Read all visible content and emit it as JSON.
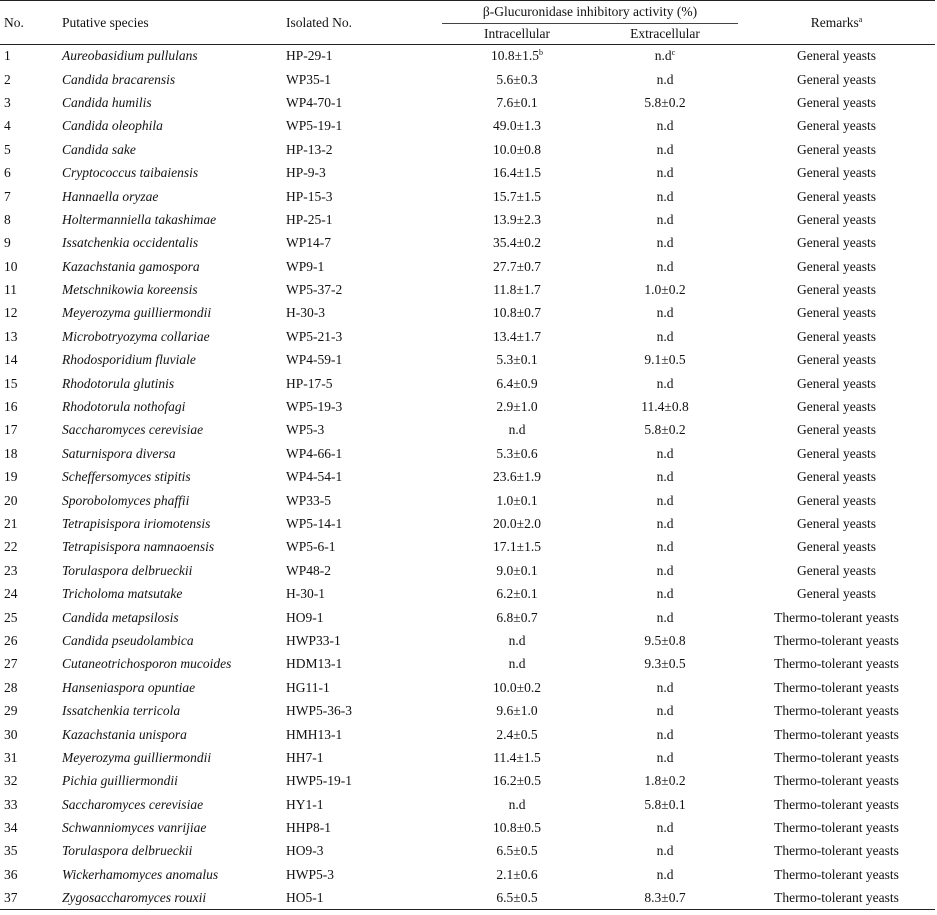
{
  "headers": {
    "no": "No.",
    "species": "Putative species",
    "isolated": "Isolated No.",
    "activity": "β-Glucuronidase inhibitory activity (%)",
    "intracellular": "Intracellular",
    "extracellular": "Extracellular",
    "remarks": "Remarks",
    "remarks_sup": "a"
  },
  "rows": [
    {
      "no": "1",
      "species": "Aureobasidium pullulans",
      "isolated": "HP-29-1",
      "intra": "10.8±1.5",
      "intra_sup": "b",
      "extra": "n.d",
      "extra_sup": "c",
      "remarks": "General yeasts"
    },
    {
      "no": "2",
      "species": "Candida bracarensis",
      "isolated": "WP35-1",
      "intra": "5.6±0.3",
      "extra": "n.d",
      "remarks": "General yeasts"
    },
    {
      "no": "3",
      "species": "Candida humilis",
      "isolated": "WP4-70-1",
      "intra": "7.6±0.1",
      "extra": "5.8±0.2",
      "remarks": "General yeasts"
    },
    {
      "no": "4",
      "species": "Candida oleophila",
      "isolated": "WP5-19-1",
      "intra": "49.0±1.3",
      "extra": "n.d",
      "remarks": "General yeasts"
    },
    {
      "no": "5",
      "species": "Candida sake",
      "isolated": "HP-13-2",
      "intra": "10.0±0.8",
      "extra": "n.d",
      "remarks": "General yeasts"
    },
    {
      "no": "6",
      "species": "Cryptococcus taibaiensis",
      "isolated": "HP-9-3",
      "intra": "16.4±1.5",
      "extra": "n.d",
      "remarks": "General yeasts"
    },
    {
      "no": "7",
      "species": "Hannaella oryzae",
      "isolated": "HP-15-3",
      "intra": "15.7±1.5",
      "extra": "n.d",
      "remarks": "General yeasts"
    },
    {
      "no": "8",
      "species": "Holtermanniella takashimae",
      "isolated": "HP-25-1",
      "intra": "13.9±2.3",
      "extra": "n.d",
      "remarks": "General yeasts"
    },
    {
      "no": "9",
      "species": "Issatchenkia occidentalis",
      "isolated": "WP14-7",
      "intra": "35.4±0.2",
      "extra": "n.d",
      "remarks": "General yeasts"
    },
    {
      "no": "10",
      "species": "Kazachstania gamospora",
      "isolated": "WP9-1",
      "intra": "27.7±0.7",
      "extra": "n.d",
      "remarks": "General yeasts"
    },
    {
      "no": "11",
      "species": "Metschnikowia koreensis",
      "isolated": "WP5-37-2",
      "intra": "11.8±1.7",
      "extra": "1.0±0.2",
      "remarks": "General yeasts"
    },
    {
      "no": "12",
      "species": "Meyerozyma guilliermondii",
      "isolated": "H-30-3",
      "intra": "10.8±0.7",
      "extra": "n.d",
      "remarks": "General yeasts"
    },
    {
      "no": "13",
      "species": "Microbotryozyma collariae",
      "isolated": "WP5-21-3",
      "intra": "13.4±1.7",
      "extra": "n.d",
      "remarks": "General yeasts"
    },
    {
      "no": "14",
      "species": "Rhodosporidium fluviale",
      "isolated": "WP4-59-1",
      "intra": "5.3±0.1",
      "extra": "9.1±0.5",
      "remarks": "General yeasts"
    },
    {
      "no": "15",
      "species": "Rhodotorula glutinis",
      "isolated": "HP-17-5",
      "intra": "6.4±0.9",
      "extra": "n.d",
      "remarks": "General yeasts"
    },
    {
      "no": "16",
      "species": "Rhodotorula nothofagi",
      "isolated": "WP5-19-3",
      "intra": "2.9±1.0",
      "extra": "11.4±0.8",
      "remarks": "General yeasts"
    },
    {
      "no": "17",
      "species": "Saccharomyces cerevisiae",
      "isolated": "WP5-3",
      "intra": "n.d",
      "extra": "5.8±0.2",
      "remarks": "General yeasts"
    },
    {
      "no": "18",
      "species": "Saturnispora diversa",
      "isolated": "WP4-66-1",
      "intra": "5.3±0.6",
      "extra": "n.d",
      "remarks": "General yeasts"
    },
    {
      "no": "19",
      "species": "Scheffersomyces stipitis",
      "isolated": "WP4-54-1",
      "intra": "23.6±1.9",
      "extra": "n.d",
      "remarks": "General yeasts"
    },
    {
      "no": "20",
      "species": "Sporobolomyces phaffii",
      "isolated": "WP33-5",
      "intra": "1.0±0.1",
      "extra": "n.d",
      "remarks": "General yeasts"
    },
    {
      "no": "21",
      "species": "Tetrapisispora iriomotensis",
      "isolated": "WP5-14-1",
      "intra": "20.0±2.0",
      "extra": "n.d",
      "remarks": "General yeasts"
    },
    {
      "no": "22",
      "species": "Tetrapisispora namnaoensis",
      "isolated": "WP5-6-1",
      "intra": "17.1±1.5",
      "extra": "n.d",
      "remarks": "General yeasts"
    },
    {
      "no": "23",
      "species": "Torulaspora delbrueckii",
      "isolated": "WP48-2",
      "intra": "9.0±0.1",
      "extra": "n.d",
      "remarks": "General yeasts"
    },
    {
      "no": "24",
      "species": "Tricholoma matsutake",
      "isolated": "H-30-1",
      "intra": "6.2±0.1",
      "extra": "n.d",
      "remarks": "General yeasts"
    },
    {
      "no": "25",
      "species": "Candida metapsilosis",
      "isolated": "HO9-1",
      "intra": "6.8±0.7",
      "extra": "n.d",
      "remarks": "Thermo-tolerant yeasts"
    },
    {
      "no": "26",
      "species": "Candida pseudolambica",
      "isolated": "HWP33-1",
      "intra": "n.d",
      "extra": "9.5±0.8",
      "remarks": "Thermo-tolerant yeasts"
    },
    {
      "no": "27",
      "species": "Cutaneotrichosporon mucoides",
      "isolated": "HDM13-1",
      "intra": "n.d",
      "extra": "9.3±0.5",
      "remarks": "Thermo-tolerant yeasts"
    },
    {
      "no": "28",
      "species": "Hanseniaspora opuntiae",
      "isolated": "HG11-1",
      "intra": "10.0±0.2",
      "extra": "n.d",
      "remarks": "Thermo-tolerant yeasts"
    },
    {
      "no": "29",
      "species": "Issatchenkia terricola",
      "isolated": "HWP5-36-3",
      "intra": "9.6±1.0",
      "extra": "n.d",
      "remarks": "Thermo-tolerant yeasts"
    },
    {
      "no": "30",
      "species": "Kazachstania unispora",
      "isolated": "HMH13-1",
      "intra": "2.4±0.5",
      "extra": "n.d",
      "remarks": "Thermo-tolerant yeasts"
    },
    {
      "no": "31",
      "species": "Meyerozyma guilliermondii",
      "isolated": "HH7-1",
      "intra": "11.4±1.5",
      "extra": "n.d",
      "remarks": "Thermo-tolerant yeasts"
    },
    {
      "no": "32",
      "species": "Pichia guilliermondii",
      "isolated": "HWP5-19-1",
      "intra": "16.2±0.5",
      "extra": "1.8±0.2",
      "remarks": "Thermo-tolerant yeasts"
    },
    {
      "no": "33",
      "species": "Saccharomyces cerevisiae",
      "isolated": "HY1-1",
      "intra": "n.d",
      "extra": "5.8±0.1",
      "remarks": "Thermo-tolerant yeasts"
    },
    {
      "no": "34",
      "species": "Schwanniomyces vanrijiae",
      "isolated": "HHP8-1",
      "intra": "10.8±0.5",
      "extra": "n.d",
      "remarks": "Thermo-tolerant yeasts"
    },
    {
      "no": "35",
      "species": "Torulaspora delbrueckii",
      "isolated": "HO9-3",
      "intra": "6.5±0.5",
      "extra": "n.d",
      "remarks": "Thermo-tolerant yeasts"
    },
    {
      "no": "36",
      "species": "Wickerhamomyces anomalus",
      "isolated": "HWP5-3",
      "intra": "2.1±0.6",
      "extra": "n.d",
      "remarks": "Thermo-tolerant yeasts"
    },
    {
      "no": "37",
      "species": "Zygosaccharomyces rouxii",
      "isolated": "HO5-1",
      "intra": "6.5±0.5",
      "extra": "8.3±0.7",
      "remarks": "Thermo-tolerant yeasts"
    }
  ]
}
